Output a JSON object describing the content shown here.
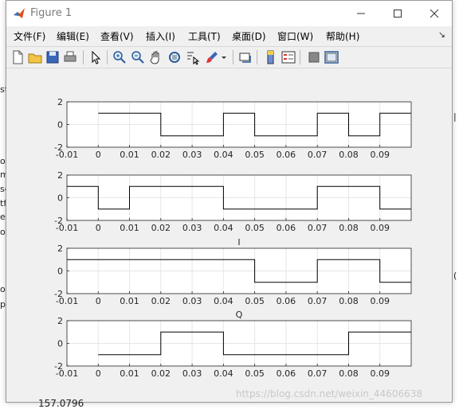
{
  "window": {
    "title": "Figure 1"
  },
  "menu": [
    "文件(F)",
    "编辑(E)",
    "查看(V)",
    "插入(I)",
    "工具(T)",
    "桌面(D)",
    "窗口(W)",
    "帮助(H)"
  ],
  "toolbar_icons": [
    "new-figure-icon",
    "open-file-icon",
    "save-icon",
    "print-icon",
    "select-arrow-icon",
    "zoom-in-icon",
    "zoom-out-icon",
    "pan-hand-icon",
    "rotate-3d-icon",
    "data-cursor-icon",
    "brush-icon",
    "brush-dropdown-icon",
    "link-plot-icon",
    "colorbar-icon",
    "legend-icon",
    "hide-plot-tools-icon",
    "show-plot-tools-icon"
  ],
  "background_fragments": [
    "st",
    "oc",
    "m",
    "sc",
    "tf",
    "ex",
    "oa",
    "oa",
    "p",
    "(",
    "|",
    "157.0796"
  ],
  "watermark": "https://blog.csdn.net/weixin_44606638",
  "chart_data": [
    {
      "type": "line",
      "title": "",
      "xlim": [
        -0.01,
        0.1
      ],
      "ylim": [
        -2,
        2
      ],
      "xticks": [
        "-0.01",
        "0",
        "0.01",
        "0.02",
        "0.03",
        "0.04",
        "0.05",
        "0.06",
        "0.07",
        "0.08",
        "0.09"
      ],
      "yticks": [
        "2",
        "0",
        "-2"
      ],
      "grid": true,
      "series": [
        {
          "step_x": [
            0,
            0.02,
            0.04,
            0.05,
            0.07,
            0.08,
            0.09,
            0.1
          ],
          "step_y": [
            1,
            -1,
            1,
            -1,
            1,
            -1,
            1
          ]
        }
      ]
    },
    {
      "type": "line",
      "title": "",
      "xlim": [
        -0.01,
        0.1
      ],
      "ylim": [
        -2,
        2
      ],
      "xticks": [
        "-0.01",
        "0",
        "0.01",
        "0.02",
        "0.03",
        "0.04",
        "0.05",
        "0.06",
        "0.07",
        "0.08",
        "0.09"
      ],
      "yticks": [
        "2",
        "0",
        "-2"
      ],
      "grid": true,
      "series": [
        {
          "step_x": [
            -0.01,
            0,
            0.01,
            0.04,
            0.07,
            0.09,
            0.1
          ],
          "step_y": [
            1,
            -1,
            1,
            -1,
            1,
            -1
          ]
        }
      ]
    },
    {
      "type": "line",
      "title": "I",
      "xlim": [
        -0.01,
        0.1
      ],
      "ylim": [
        -2,
        2
      ],
      "xticks": [
        "-0.01",
        "0",
        "0.01",
        "0.02",
        "0.03",
        "0.04",
        "0.05",
        "0.06",
        "0.07",
        "0.08",
        "0.09"
      ],
      "yticks": [
        "2",
        "0",
        "-2"
      ],
      "grid": true,
      "series": [
        {
          "step_x": [
            -0.01,
            0.05,
            0.07,
            0.09,
            0.1
          ],
          "step_y": [
            1,
            -1,
            1,
            -1
          ]
        }
      ]
    },
    {
      "type": "line",
      "title": "Q",
      "xlim": [
        -0.01,
        0.1
      ],
      "ylim": [
        -2,
        2
      ],
      "xticks": [
        "-0.01",
        "0",
        "0.01",
        "0.02",
        "0.03",
        "0.04",
        "0.05",
        "0.06",
        "0.07",
        "0.08",
        "0.09"
      ],
      "yticks": [
        "2",
        "0",
        "-2"
      ],
      "grid": true,
      "series": [
        {
          "step_x": [
            0,
            0.02,
            0.04,
            0.08,
            0.1
          ],
          "step_y": [
            -1,
            1,
            -1,
            1
          ]
        }
      ]
    }
  ]
}
